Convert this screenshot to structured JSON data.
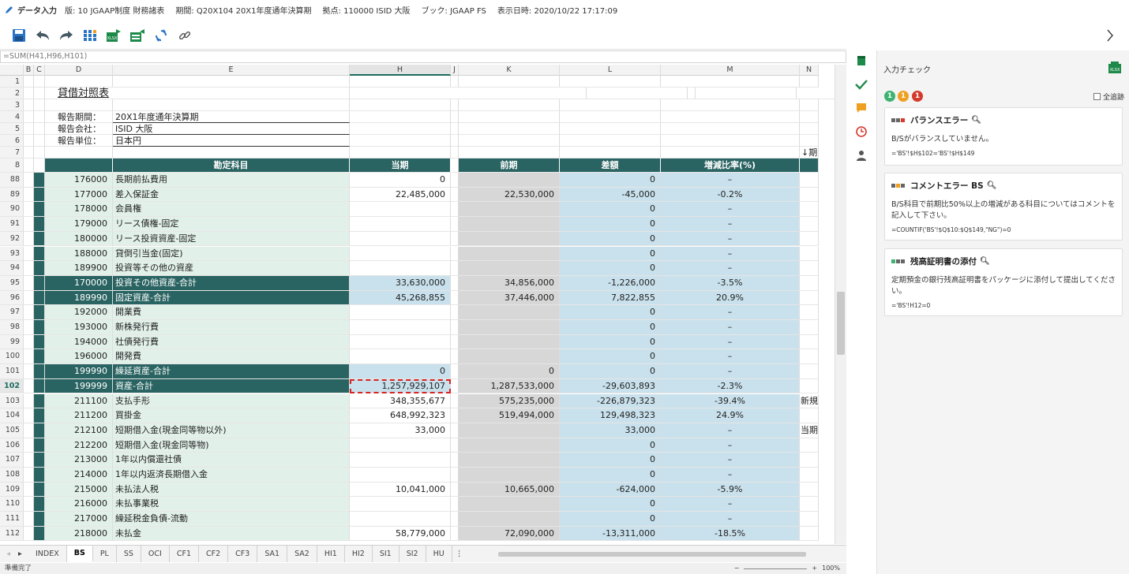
{
  "titlebar": {
    "title": "データ入力",
    "edition": "版: 10 JGAAP制度 財務諸表",
    "period": "期間: Q20X104 20X1年度通年決算期",
    "site": "拠点: 110000 ISID 大阪",
    "book": "ブック: JGAAP FS",
    "display_time": "表示日時: 2020/10/22 17:17:09"
  },
  "toolbar": {
    "icons": [
      "save-icon",
      "undo-icon",
      "redo-icon",
      "grid-icon",
      "excel-export-icon",
      "excel-import-icon",
      "refresh-icon",
      "link-icon"
    ]
  },
  "formula_bar": "=SUM(H41,H96,H101)",
  "columns": [
    "B",
    "C",
    "D",
    "E",
    "H",
    "J",
    "K",
    "L",
    "M",
    "N"
  ],
  "top_rows": {
    "r1": "1",
    "r2": "2",
    "r3": "3",
    "r4": "4",
    "r5": "5",
    "r6": "6",
    "r7": "7",
    "r8": "8",
    "title": "貸借対照表",
    "period_label": "報告期間：",
    "period_value": "20X1年度通年決算期",
    "company_label": "報告会社：",
    "company_value": "ISID 大阪",
    "unit_label": "報告単位：",
    "unit_value": "日本円",
    "arrow_text": "↓期"
  },
  "headers": {
    "account": "勘定科目",
    "current": "当期",
    "previous": "前期",
    "diff": "差額",
    "ratio": "増減比率(%)"
  },
  "rows": [
    {
      "row": "88",
      "code": "176000",
      "name": "長期前払費用",
      "current": "0",
      "previous": "",
      "diff": "0",
      "ratio": "–",
      "sum": false,
      "n": ""
    },
    {
      "row": "89",
      "code": "177000",
      "name": "差入保証金",
      "current": "22,485,000",
      "previous": "22,530,000",
      "diff": "-45,000",
      "ratio": "-0.2%",
      "sum": false,
      "n": ""
    },
    {
      "row": "90",
      "code": "178000",
      "name": "会員権",
      "current": "",
      "previous": "",
      "diff": "0",
      "ratio": "–",
      "sum": false,
      "n": ""
    },
    {
      "row": "91",
      "code": "179000",
      "name": "リース債権-固定",
      "current": "",
      "previous": "",
      "diff": "0",
      "ratio": "–",
      "sum": false,
      "n": ""
    },
    {
      "row": "92",
      "code": "180000",
      "name": "リース投資資産-固定",
      "current": "",
      "previous": "",
      "diff": "0",
      "ratio": "–",
      "sum": false,
      "n": ""
    },
    {
      "row": "93",
      "code": "188000",
      "name": "貸倒引当金(固定)",
      "current": "",
      "previous": "",
      "diff": "0",
      "ratio": "–",
      "sum": false,
      "n": ""
    },
    {
      "row": "94",
      "code": "189900",
      "name": "投資等その他の資産",
      "current": "",
      "previous": "",
      "diff": "0",
      "ratio": "–",
      "sum": false,
      "n": ""
    },
    {
      "row": "95",
      "code": "170000",
      "name": "投資その他資産-合計",
      "current": "33,630,000",
      "previous": "34,856,000",
      "diff": "-1,226,000",
      "ratio": "-3.5%",
      "sum": true,
      "n": ""
    },
    {
      "row": "96",
      "code": "189990",
      "name": "固定資産-合計",
      "current": "45,268,855",
      "previous": "37,446,000",
      "diff": "7,822,855",
      "ratio": "20.9%",
      "sum": true,
      "n": ""
    },
    {
      "row": "97",
      "code": "192000",
      "name": "開業費",
      "current": "",
      "previous": "",
      "diff": "0",
      "ratio": "–",
      "sum": false,
      "n": ""
    },
    {
      "row": "98",
      "code": "193000",
      "name": "新株発行費",
      "current": "",
      "previous": "",
      "diff": "0",
      "ratio": "–",
      "sum": false,
      "n": ""
    },
    {
      "row": "99",
      "code": "194000",
      "name": "社債発行費",
      "current": "",
      "previous": "",
      "diff": "0",
      "ratio": "–",
      "sum": false,
      "n": ""
    },
    {
      "row": "100",
      "code": "196000",
      "name": "開発費",
      "current": "",
      "previous": "",
      "diff": "0",
      "ratio": "–",
      "sum": false,
      "n": ""
    },
    {
      "row": "101",
      "code": "199990",
      "name": "繰延資産-合計",
      "current": "0",
      "previous": "0",
      "diff": "0",
      "ratio": "–",
      "sum": true,
      "n": ""
    },
    {
      "row": "102",
      "code": "199999",
      "name": "資産-合計",
      "current": "1,257,929,107",
      "previous": "1,287,533,000",
      "diff": "-29,603,893",
      "ratio": "-2.3%",
      "sum": true,
      "n": ""
    },
    {
      "row": "103",
      "code": "211100",
      "name": "支払手形",
      "current": "348,355,677",
      "previous": "575,235,000",
      "diff": "-226,879,323",
      "ratio": "-39.4%",
      "sum": false,
      "n": "新規"
    },
    {
      "row": "104",
      "code": "211200",
      "name": "買掛金",
      "current": "648,992,323",
      "previous": "519,494,000",
      "diff": "129,498,323",
      "ratio": "24.9%",
      "sum": false,
      "n": ""
    },
    {
      "row": "105",
      "code": "212100",
      "name": "短期借入金(現金同等物以外)",
      "current": "33,000",
      "previous": "",
      "diff": "33,000",
      "ratio": "–",
      "sum": false,
      "n": "当期"
    },
    {
      "row": "106",
      "code": "212200",
      "name": "短期借入金(現金同等物)",
      "current": "",
      "previous": "",
      "diff": "0",
      "ratio": "–",
      "sum": false,
      "n": ""
    },
    {
      "row": "107",
      "code": "213000",
      "name": "1年以内償還社債",
      "current": "",
      "previous": "",
      "diff": "0",
      "ratio": "–",
      "sum": false,
      "n": ""
    },
    {
      "row": "108",
      "code": "214000",
      "name": "1年以内返済長期借入金",
      "current": "",
      "previous": "",
      "diff": "0",
      "ratio": "–",
      "sum": false,
      "n": ""
    },
    {
      "row": "109",
      "code": "215000",
      "name": "未払法人税",
      "current": "10,041,000",
      "previous": "10,665,000",
      "diff": "-624,000",
      "ratio": "-5.9%",
      "sum": false,
      "n": ""
    },
    {
      "row": "110",
      "code": "216000",
      "name": "未払事業税",
      "current": "",
      "previous": "",
      "diff": "0",
      "ratio": "–",
      "sum": false,
      "n": ""
    },
    {
      "row": "111",
      "code": "217000",
      "name": "繰延税金負債-流動",
      "current": "",
      "previous": "",
      "diff": "0",
      "ratio": "–",
      "sum": false,
      "n": ""
    },
    {
      "row": "112",
      "code": "218000",
      "name": "未払金",
      "current": "58,779,000",
      "previous": "72,090,000",
      "diff": "-13,311,000",
      "ratio": "-18.5%",
      "sum": false,
      "n": ""
    }
  ],
  "sheet_tabs": [
    "INDEX",
    "BS",
    "PL",
    "SS",
    "OCI",
    "CF1",
    "CF2",
    "CF3",
    "SA1",
    "SA2",
    "HI1",
    "HI2",
    "SI1",
    "SI2",
    "HU"
  ],
  "active_tab": "BS",
  "status": {
    "text": "準備完了",
    "zoom": "100%",
    "minus": "−",
    "plus": "+"
  },
  "side_icons": [
    "book-icon",
    "check-icon",
    "comment-icon",
    "clock-icon",
    "user-icon"
  ],
  "panel": {
    "title": "入力チェック",
    "badges": [
      {
        "count": "1",
        "color": "#3cb371"
      },
      {
        "count": "1",
        "color": "#f0a020"
      },
      {
        "count": "1",
        "color": "#d33a2c"
      }
    ],
    "trace_label": "全追跡",
    "cards": [
      {
        "title": "バランスエラー",
        "lamp": "red",
        "message": "B/Sがバランスしていません。",
        "formula": "='BS'!$H$102='BS'!$H$149"
      },
      {
        "title": "コメントエラー BS",
        "lamp": "yellow",
        "message": "B/S科目で前期比50%以上の増減がある科目についてはコメントを記入して下さい。",
        "formula": "=COUNTIF('BS'!$Q$10:$Q$149,\"NG\")=0"
      },
      {
        "title": "残高証明書の添付",
        "lamp": "green",
        "message": "定期預金の銀行残高証明書をパッケージに添付して提出してください。",
        "formula": "='BS'!H12=0"
      }
    ]
  },
  "colors": {
    "header_teal": "#2a6462",
    "light_green": "#e2f0ea",
    "gray_cell": "#d7d7d7",
    "blue_cell": "#c9e1ec",
    "selection": "#d62424",
    "toolbar_blue": "#2a74c4",
    "toolbar_green": "#1e8a4a"
  }
}
